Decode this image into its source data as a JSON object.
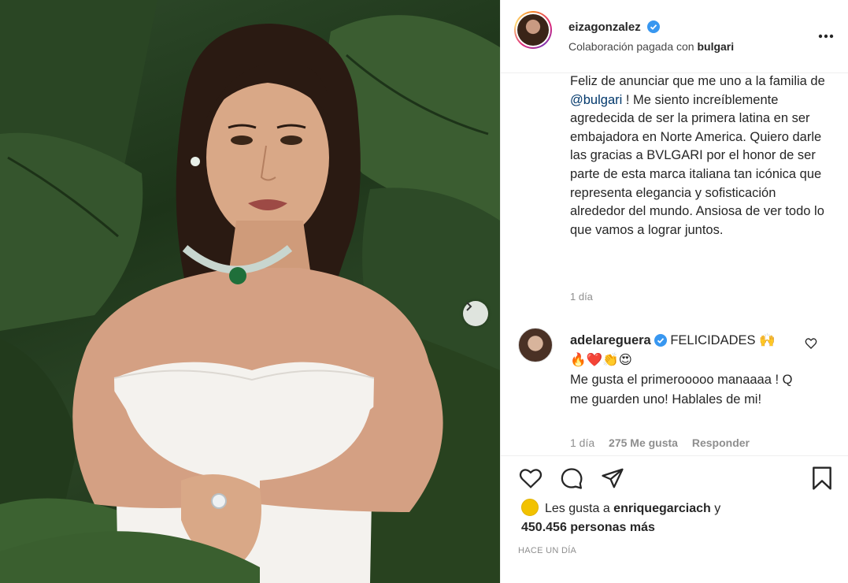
{
  "post": {
    "photo_alt": "eizagonzalez post photo",
    "header": {
      "username": "eizagonzalez",
      "sub_prefix": "Colaboración pagada con",
      "sub_brand": "bulgari"
    },
    "caption": {
      "part1": "Feliz de anunciar que me uno a la familia de ",
      "mention": "@bulgari",
      "part2": " ! Me siento increíblemente agredecida de ser la primera latina en ser embajadora en Norte America. Quiero darle las gracias a BVLGARI por el honor de ser parte de esta marca italiana tan icónica que representa elegancia y sofisticación alrededor del mundo. Ansiosa de ver todo lo que vamos a lograr juntos.",
      "time": "1 día"
    },
    "comment": {
      "username": "adelareguera",
      "text1": " FELICIDADES 🙌",
      "emojis": "🔥❤️👏😍",
      "text2": "Me gusta el primerooooo manaaaa ! Q me guarden uno! Hablales de mi!",
      "time": "1 día",
      "likes": "275 Me gusta",
      "reply": "Responder"
    },
    "likes": {
      "prefix": "Les gusta a ",
      "user": "enriquegarciach",
      "mid": " y",
      "count": "450.456 personas más"
    },
    "timestamp": "HACE UN DÍA",
    "colors": {
      "text": "#262626",
      "muted": "#8e8e8e",
      "mention": "#00376b",
      "verified": "#3897f0",
      "border": "#efefef"
    },
    "icons": {
      "more": "more-horizontal-icon",
      "like": "heart-icon",
      "comment": "comment-bubble-icon",
      "share": "paper-plane-icon",
      "save": "bookmark-icon",
      "next": "chevron-right-icon",
      "verified": "verified-badge-icon"
    }
  }
}
